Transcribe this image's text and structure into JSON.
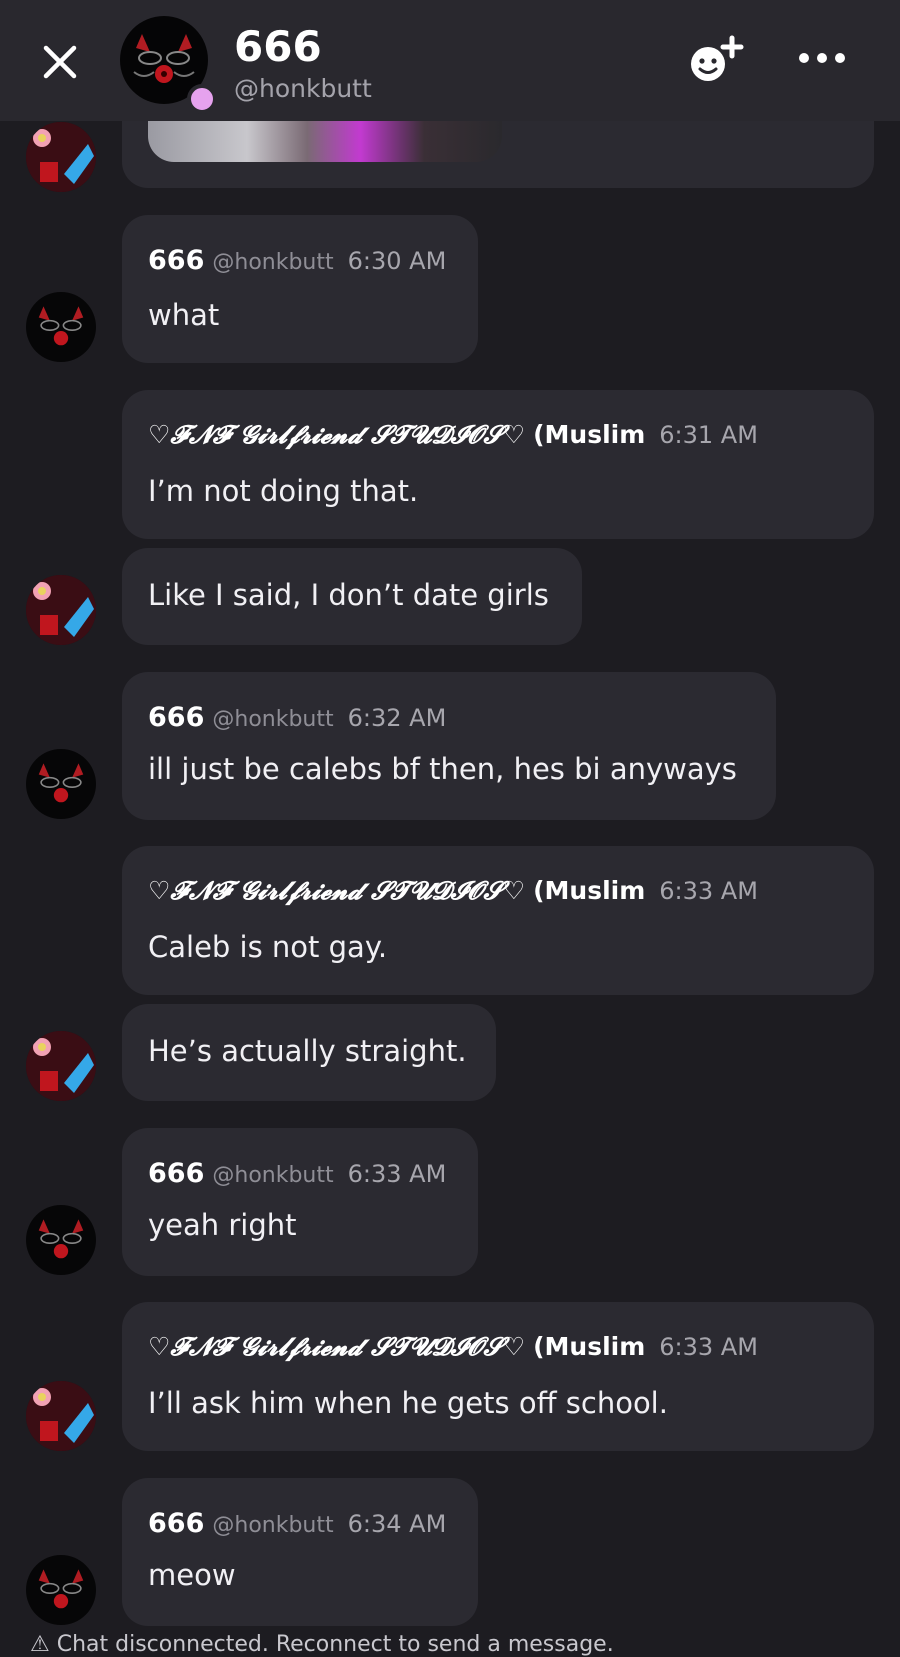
{
  "header": {
    "title": "666",
    "handle": "@honkbutt"
  },
  "messages": [
    {
      "name": "666",
      "handle": "@honkbutt",
      "time": "6:30 AM",
      "text": "what"
    },
    {
      "name": "♡𝓕𝓝𝓕 𝓖𝓲𝓻𝓵𝓯𝓻𝓲𝓮𝓷𝓭 𝓢𝓣𝓤𝓓𝓘𝓞𝓢♡",
      "suffix": "(Muslim",
      "time": "6:31 AM",
      "text": "I’m not doing that.",
      "text2": "Like I said, I don’t date girls"
    },
    {
      "name": "666",
      "handle": "@honkbutt",
      "time": "6:32 AM",
      "text": "ill just be calebs bf then, hes bi anyways"
    },
    {
      "name": "♡𝓕𝓝𝓕 𝓖𝓲𝓻𝓵𝓯𝓻𝓲𝓮𝓷𝓭 𝓢𝓣𝓤𝓓𝓘𝓞𝓢♡",
      "suffix": "(Muslim",
      "time": "6:33 AM",
      "text": "Caleb is not gay.",
      "text2": "He’s actually straight."
    },
    {
      "name": "666",
      "handle": "@honkbutt",
      "time": "6:33 AM",
      "text": "yeah right"
    },
    {
      "name": "♡𝓕𝓝𝓕 𝓖𝓲𝓻𝓵𝓯𝓻𝓲𝓮𝓷𝓭 𝓢𝓣𝓤𝓓𝓘𝓞𝓢♡",
      "suffix": "(Muslim",
      "time": "6:33 AM",
      "text": "I’ll ask him when he gets off school."
    },
    {
      "name": "666",
      "handle": "@honkbutt",
      "time": "6:34 AM",
      "text": "meow"
    }
  ],
  "footer": {
    "notice": "⚠ Chat disconnected. Reconnect to send a message."
  },
  "colors": {
    "background": "#1d1c21",
    "bubble": "#2b2a31",
    "header": "#29282e",
    "status_dot": "#e6a2ee"
  },
  "icons": [
    "close-icon",
    "add-friend-icon",
    "more-icon"
  ]
}
